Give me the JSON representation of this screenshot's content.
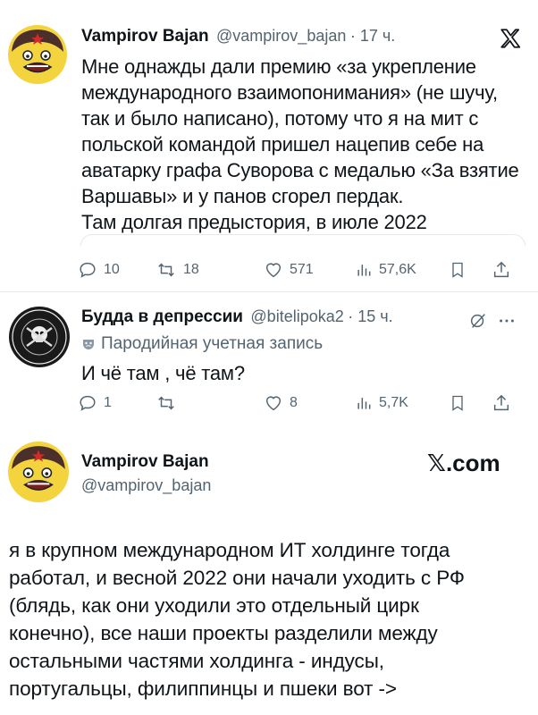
{
  "tweet1": {
    "display_name": "Vampirov Bajan",
    "handle": "@vampirov_bajan",
    "time": "· 17 ч.",
    "lines": [
      "Мне однажды дали премию «за укрепление",
      "международного взаимопонимания» (не шучу,",
      "так и было написано), потому что я на мит с",
      "польской командой пришел нацепив себе на",
      "аватарку графа Суворова с медалью «За взятие",
      "Варшавы» и у панов сгорел пердак.",
      "Там долгая предыстория, в июле 2022"
    ],
    "stats": {
      "replies": "10",
      "retweets": "18",
      "likes": "571",
      "views": "57,6K"
    }
  },
  "tweet2": {
    "display_name": "Будда в депрессии",
    "handle": "@bitelipoka2",
    "time": "· 15 ч.",
    "parody_label": "Пародийная учетная запись",
    "text": "И чё там , чё там?",
    "stats": {
      "replies": "1",
      "retweets": "",
      "likes": "8",
      "views": "5,7K"
    }
  },
  "card": {
    "display_name": "Vampirov Bajan",
    "handle": "@vampirov_bajan",
    "site": "𝕏.com",
    "lines": [
      "я в крупном международном ИТ холдинге тогда",
      "работал, и весной 2022 они начали уходить с РФ",
      "(блядь, как они уходили это отдельный цирк",
      "конечно), все наши проекты разделили между",
      "остальными частями холдинга - индусы,",
      "португальцы, филиппинцы и пшеки вот ->"
    ]
  },
  "icons": [
    "x-logo-icon",
    "reply-icon",
    "retweet-icon",
    "like-icon",
    "views-icon",
    "bookmark-icon",
    "share-icon",
    "grok-icon",
    "more-icon",
    "parody-mask-icon"
  ],
  "colors": {
    "text": "#0f1419",
    "muted": "#536471",
    "avatar_yellow": "#f2d23c"
  }
}
